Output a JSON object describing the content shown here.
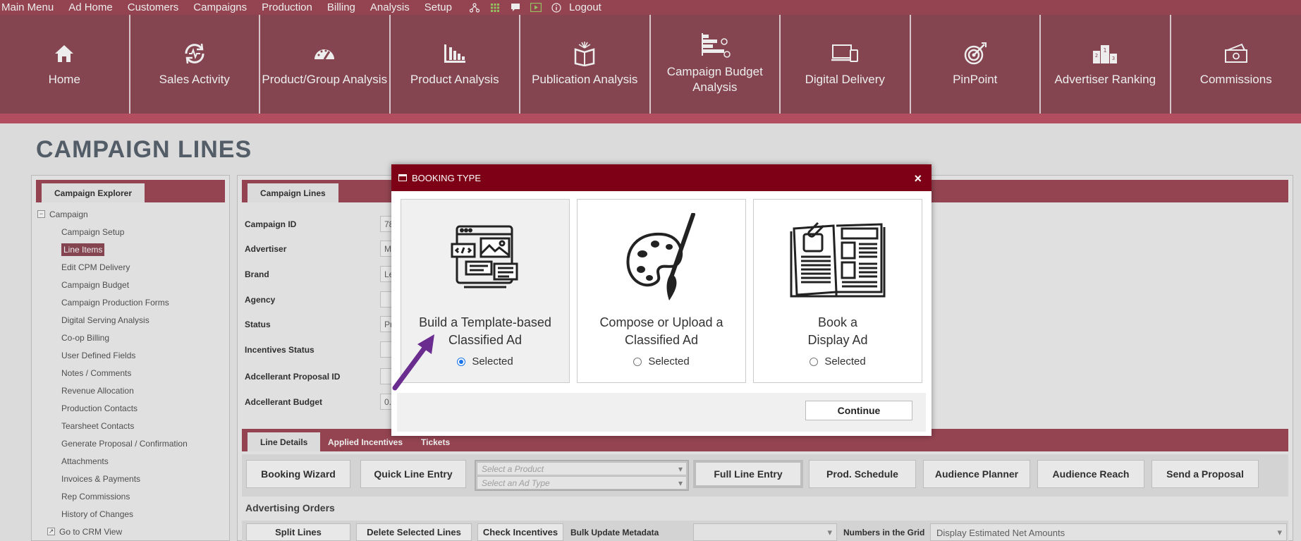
{
  "topmenu": {
    "items": [
      "Main Menu",
      "Ad Home",
      "Customers",
      "Campaigns",
      "Production",
      "Billing",
      "Analysis",
      "Setup"
    ],
    "logout": "Logout"
  },
  "ribbon": {
    "items": [
      "Home",
      "Sales Activity",
      "Product/Group Analysis",
      "Product Analysis",
      "Publication Analysis",
      "Campaign Budget Analysis",
      "Digital Delivery",
      "PinPoint",
      "Advertiser Ranking",
      "Commissions"
    ]
  },
  "page": {
    "title": "CAMPAIGN LINES"
  },
  "explorer": {
    "tab": "Campaign Explorer",
    "root": "Campaign",
    "items": [
      "Campaign Setup",
      "Line Items",
      "Edit CPM Delivery",
      "Campaign Budget",
      "Campaign Production Forms",
      "Digital Serving Analysis",
      "Co-op Billing",
      "User Defined Fields",
      "Notes / Comments",
      "Revenue Allocation",
      "Production Contacts",
      "Tearsheet Contacts",
      "Generate Proposal / Confirmation",
      "Attachments",
      "Invoices & Payments",
      "Rep Commissions",
      "History of Changes"
    ],
    "crm": "Go to CRM View"
  },
  "campaign_lines": {
    "tab": "Campaign Lines",
    "fields": [
      {
        "label": "Campaign ID",
        "value": "78"
      },
      {
        "label": "Advertiser",
        "value": "M"
      },
      {
        "label": "Brand",
        "value": "Le"
      },
      {
        "label": "Agency",
        "value": ""
      },
      {
        "label": "Status",
        "value": "Pr"
      },
      {
        "label": "Incentives Status",
        "value": ""
      },
      {
        "label": "Adcellerant Proposal ID",
        "value": ""
      },
      {
        "label": "Adcellerant Budget",
        "value": "0."
      }
    ],
    "lower_tabs": [
      "Line Details",
      "Applied Incentives",
      "Tickets"
    ],
    "buttons": [
      "Booking Wizard",
      "Quick Line Entry",
      "Full Line Entry",
      "Prod. Schedule",
      "Audience Planner",
      "Audience Reach",
      "Send a Proposal"
    ],
    "product_placeholder": "Select a Product",
    "adtype_placeholder": "Select an Ad Type",
    "orders_title": "Advertising Orders",
    "order_buttons": [
      "Split Lines",
      "Delete Selected Lines",
      "Check Incentives"
    ],
    "bulk_label": "Bulk Update Metadata",
    "numbers_label": "Numbers in the Grid",
    "numbers_value": "Display Estimated Net Amounts"
  },
  "modal": {
    "title": "BOOKING TYPE",
    "close": "×",
    "options": [
      {
        "title": "Build a Template-based\nClassified Ad",
        "radio": "Selected",
        "checked": true
      },
      {
        "title": "Compose or Upload a\nClassified Ad",
        "radio": "Selected",
        "checked": false
      },
      {
        "title": "Book a\nDisplay Ad",
        "radio": "Selected",
        "checked": false
      }
    ],
    "continue": "Continue"
  },
  "colors": {
    "menu": "#a04a58",
    "ribbon": "#8f4b58",
    "modal_header": "#7e0016",
    "arrow": "#6a2c8f"
  }
}
